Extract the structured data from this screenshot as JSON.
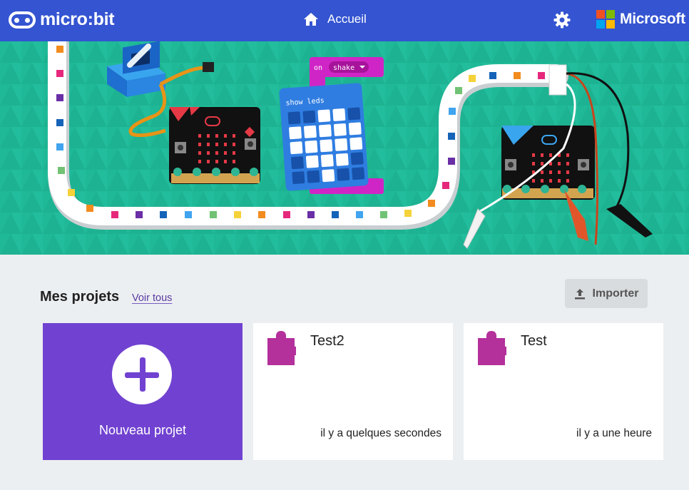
{
  "header": {
    "logo_text": "micro:bit",
    "home_label": "Accueil",
    "settings_icon": "gear-icon",
    "brand_text": "Microsoft",
    "colors": {
      "bar": "#3454d1",
      "ms_red": "#f25022",
      "ms_green": "#7fba00",
      "ms_blue": "#00a4ef",
      "ms_yellow": "#ffb900"
    }
  },
  "banner": {
    "block_event": "on",
    "block_event_arg": "shake",
    "block_show_leds": "show leds"
  },
  "projects": {
    "title": "Mes projets",
    "see_all": "Voir tous",
    "import_label": "Importer",
    "new_project_label": "Nouveau projet",
    "items": [
      {
        "name": "Test2",
        "time": "il y a quelques secondes"
      },
      {
        "name": "Test",
        "time": "il y a une heure"
      }
    ],
    "colors": {
      "new_card": "#7142d1",
      "puzzle": "#b4309b"
    }
  }
}
